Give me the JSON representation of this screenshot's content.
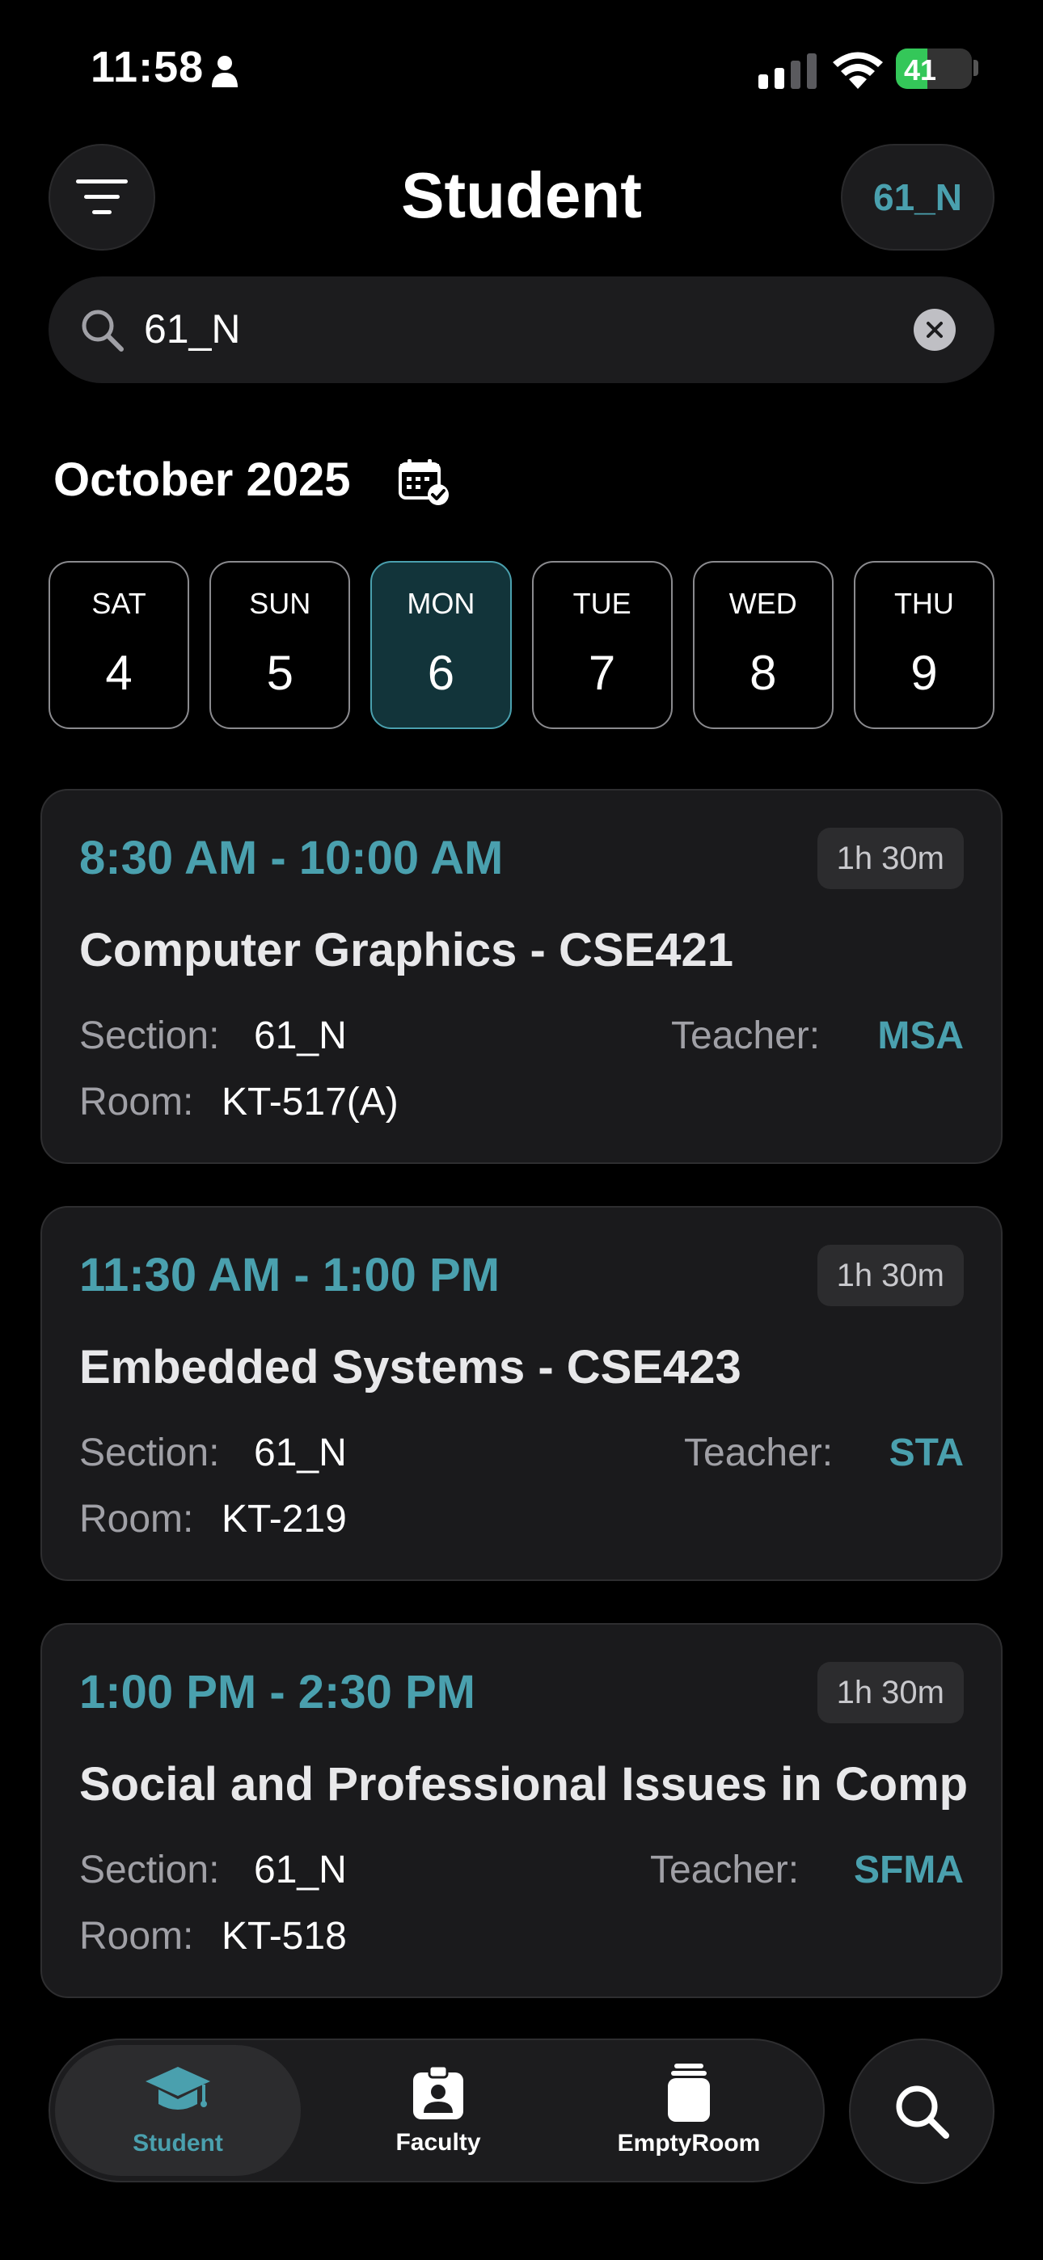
{
  "status_bar": {
    "time": "11:58",
    "battery": "41",
    "battery_level": 0.41
  },
  "header": {
    "title": "Student",
    "section_chip": "61_N"
  },
  "search": {
    "value": "61_N"
  },
  "calendar": {
    "month": "October 2025",
    "days": [
      {
        "name": "SAT",
        "num": "4",
        "selected": false
      },
      {
        "name": "SUN",
        "num": "5",
        "selected": false
      },
      {
        "name": "MON",
        "num": "6",
        "selected": true
      },
      {
        "name": "TUE",
        "num": "7",
        "selected": false
      },
      {
        "name": "WED",
        "num": "8",
        "selected": false
      },
      {
        "name": "THU",
        "num": "9",
        "selected": false
      }
    ]
  },
  "labels": {
    "section": "Section:",
    "teacher": "Teacher:",
    "room": "Room:"
  },
  "classes": [
    {
      "time": "8:30 AM - 10:00 AM",
      "duration": "1h 30m",
      "course": "Computer Graphics - CSE421",
      "section": "61_N",
      "teacher": "MSA",
      "room": "KT-517(A)"
    },
    {
      "time": "11:30 AM - 1:00 PM",
      "duration": "1h 30m",
      "course": "Embedded Systems - CSE423",
      "section": "61_N",
      "teacher": "STA",
      "room": "KT-219"
    },
    {
      "time": "1:00 PM - 2:30 PM",
      "duration": "1h 30m",
      "course": "Social and Professional Issues in Comp",
      "section": "61_N",
      "teacher": "SFMA",
      "room": "KT-518"
    }
  ],
  "tabs": [
    {
      "label": "Student",
      "icon": "graduation-cap-icon",
      "active": true
    },
    {
      "label": "Faculty",
      "icon": "id-badge-icon",
      "active": false
    },
    {
      "label": "EmptyRoom",
      "icon": "empty-room-icon",
      "active": false
    }
  ],
  "colors": {
    "accent": "#4aa0ae",
    "card": "#1a1a1c",
    "selected_day": "#12343a"
  }
}
